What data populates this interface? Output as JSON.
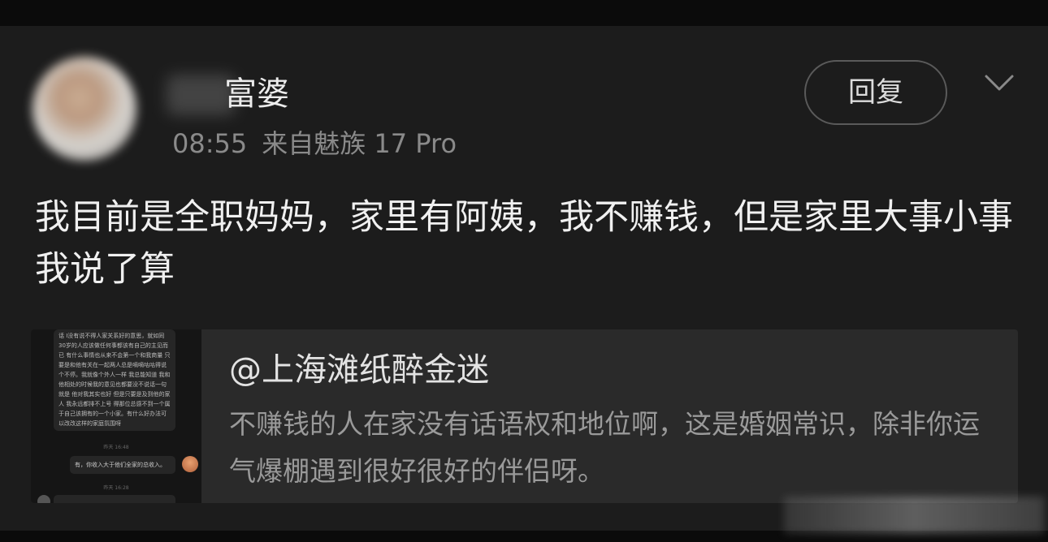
{
  "post": {
    "username_visible": "富婆",
    "time": "08:55",
    "source": "来自魅族 17 Pro",
    "reply_label": "回复",
    "text": "我目前是全职妈妈，家里有阿姨，我不赚钱，但是家里大事小事我说了算"
  },
  "quote": {
    "mention": "@上海滩纸醉金迷",
    "text": "不赚钱的人在家没有话语权和地位啊，这是婚姻常识，除非你运气爆棚遇到很好很好的伴侣呀。",
    "thumbnail": {
      "bubble_text": "话 I没有说不得人家关系好的意思，就如同30岁的人应该做任何事都该有自己的主见而已 有什么事情也从来不会第一个和我商量 只要是和他有关在一起两人总是嘀嘀咕咕得说个不停。我就像个外人一样 我总能知道 我和他相处的时候我的意见也都要没不说话一句就是 他对我其实也好 但是只要是及到他的家人 我永远都排不上号 得那位总感不到一个属于自己该拥有的一个小家。有什么好办法可以改改这样的家庭氛围呀",
      "time1": "昨天 16:48",
      "msg": "有，你收入大于他们全家的总收入。",
      "time2": "昨天 16:28"
    }
  },
  "icons": {
    "chevron": "chevron-down-icon"
  }
}
